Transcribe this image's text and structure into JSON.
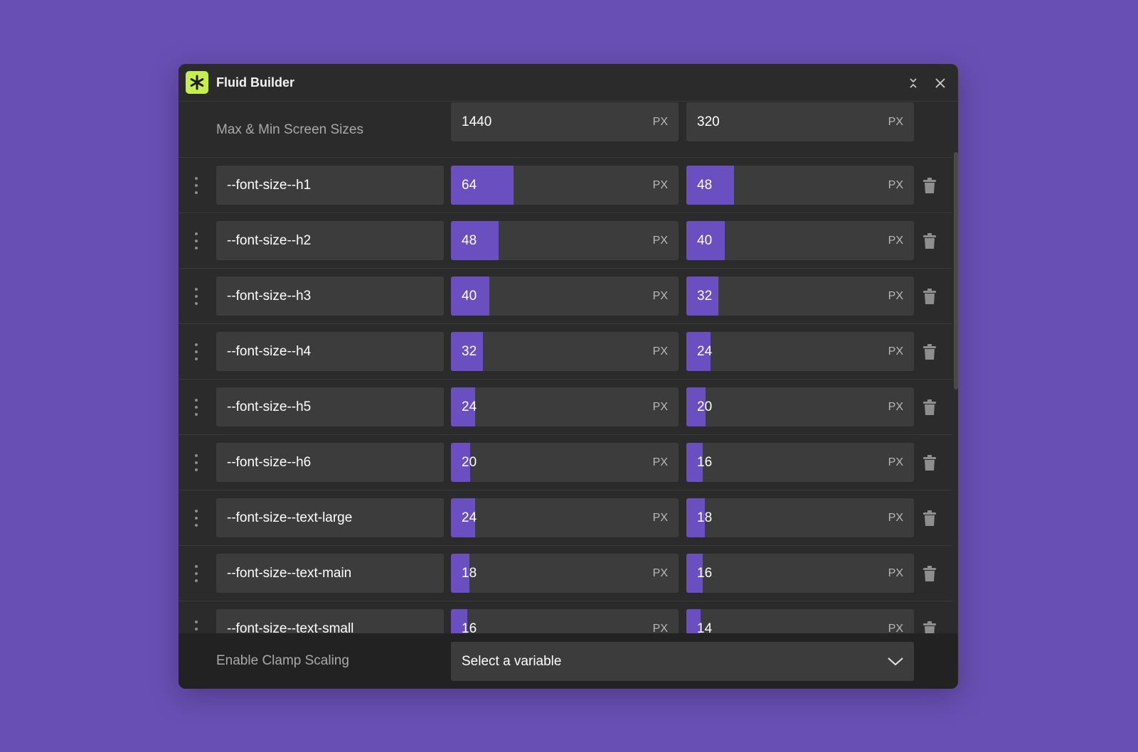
{
  "app": {
    "title": "Fluid Builder",
    "icon": "asterisk-icon",
    "accent_color": "#6a4fc0",
    "logo_color": "#c4ef4f"
  },
  "screen_sizes": {
    "label": "Max & Min Screen Sizes",
    "max": "1440",
    "min": "320",
    "unit": "PX"
  },
  "variables": [
    {
      "name": "--font-size--h1",
      "max": "64",
      "min": "48",
      "max_level": 0.275,
      "min_level": 0.21
    },
    {
      "name": "--font-size--h2",
      "max": "48",
      "min": "40",
      "max_level": 0.21,
      "min_level": 0.17
    },
    {
      "name": "--font-size--h3",
      "max": "40",
      "min": "32",
      "max_level": 0.17,
      "min_level": 0.14
    },
    {
      "name": "--font-size--h4",
      "max": "32",
      "min": "24",
      "max_level": 0.14,
      "min_level": 0.105
    },
    {
      "name": "--font-size--h5",
      "max": "24",
      "min": "20",
      "max_level": 0.105,
      "min_level": 0.085
    },
    {
      "name": "--font-size--h6",
      "max": "20",
      "min": "16",
      "max_level": 0.085,
      "min_level": 0.072
    },
    {
      "name": "--font-size--text-large",
      "max": "24",
      "min": "18",
      "max_level": 0.105,
      "min_level": 0.08
    },
    {
      "name": "--font-size--text-main",
      "max": "18",
      "min": "16",
      "max_level": 0.08,
      "min_level": 0.072
    },
    {
      "name": "--font-size--text-small",
      "max": "16",
      "min": "14",
      "max_level": 0.072,
      "min_level": 0.062
    }
  ],
  "unit": "PX",
  "footer": {
    "label": "Enable Clamp Scaling",
    "select_value": "Select a variable"
  }
}
